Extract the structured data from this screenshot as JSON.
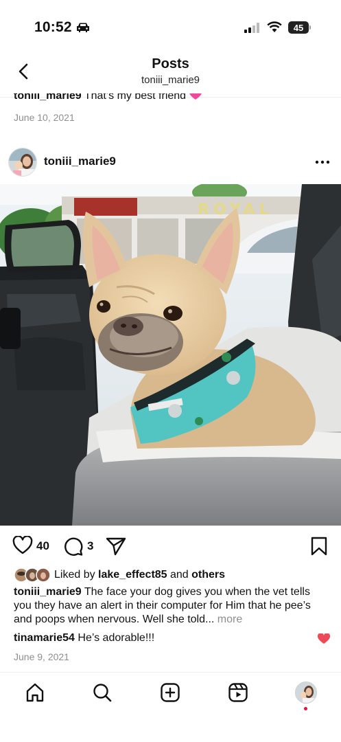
{
  "status_bar": {
    "time": "10:52",
    "battery": "45"
  },
  "header": {
    "title": "Posts",
    "subtitle": "toniii_marie9"
  },
  "previous_post": {
    "username": "toniii_marie9",
    "caption": "That’s my best friend",
    "date": "June 10, 2021"
  },
  "post": {
    "username": "toniii_marie9",
    "likes_count": "40",
    "comments_count": "3",
    "liked_by_prefix": "Liked by ",
    "liked_by_user": "lake_effect85",
    "liked_by_and": " and ",
    "liked_by_others": "others",
    "caption_user": "toniii_marie9",
    "caption_text": " The face your dog gives you when the vet tells you they have an alert in their computer for Him that he pee’s and poops when nervous. Well she told...",
    "caption_more": " more",
    "comment_user": "tinamarie54",
    "comment_text": " He’s adorable!!!",
    "date": "June 9, 2021",
    "photo_sign_text": "ROYAL"
  },
  "icons": {
    "back": "chevron-left-icon",
    "more": "ellipsis-icon",
    "like": "heart-icon",
    "comment": "comment-bubble-icon",
    "share": "paper-plane-icon",
    "save": "bookmark-icon",
    "nav": [
      "home-icon",
      "search-icon",
      "create-plus-icon",
      "reels-icon",
      "profile-avatar"
    ]
  },
  "colors": {
    "accent_red": "#ed4956",
    "text_secondary": "#8e8e8e",
    "notification_dot": "#ed0d3e"
  }
}
